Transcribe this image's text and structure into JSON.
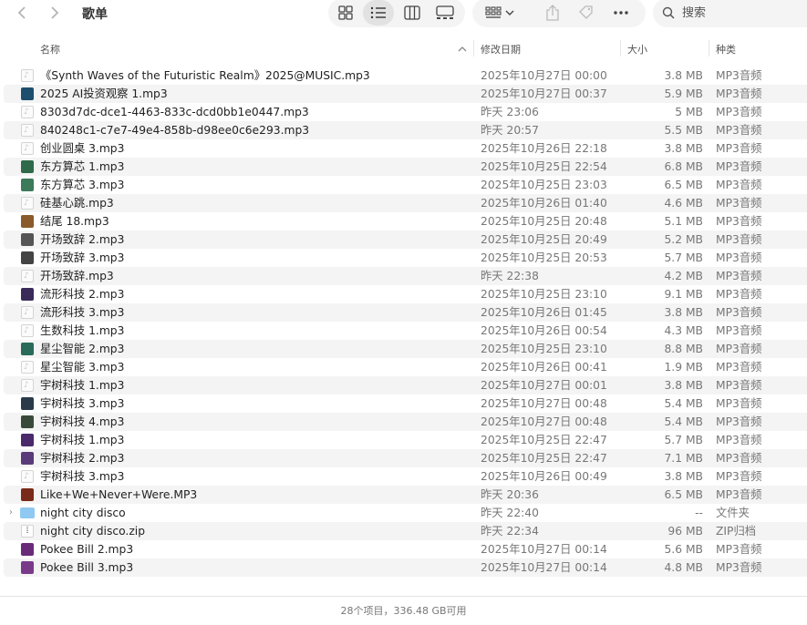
{
  "window": {
    "title": "歌单"
  },
  "toolbar": {
    "search_placeholder": "搜索"
  },
  "columns": {
    "name": "名称",
    "date": "修改日期",
    "size": "大小",
    "kind": "种类"
  },
  "rows": [
    {
      "icon": "doc",
      "name": "《Synth Waves of the Futuristic Realm》2025@MUSIC.mp3",
      "date": "2025年10月27日 00:00",
      "size": "3.8 MB",
      "kind": "MP3音频"
    },
    {
      "icon": "art",
      "color": "#1d4e6e",
      "name": "2025 AI投资观察 1.mp3",
      "date": "2025年10月27日 00:37",
      "size": "5.9 MB",
      "kind": "MP3音频"
    },
    {
      "icon": "doc",
      "name": "8303d7dc-dce1-4463-833c-dcd0bb1e0447.mp3",
      "date": "昨天 23:06",
      "size": "5 MB",
      "kind": "MP3音频"
    },
    {
      "icon": "doc",
      "name": "840248c1-c7e7-49e4-858b-d98ee0c6e293.mp3",
      "date": "昨天 20:57",
      "size": "5.5 MB",
      "kind": "MP3音频"
    },
    {
      "icon": "doc",
      "name": "创业圆桌 3.mp3",
      "date": "2025年10月26日 22:18",
      "size": "3.8 MB",
      "kind": "MP3音频"
    },
    {
      "icon": "art",
      "color": "#2f6a4a",
      "name": "东方算芯 1.mp3",
      "date": "2025年10月25日 22:54",
      "size": "6.8 MB",
      "kind": "MP3音频"
    },
    {
      "icon": "art",
      "color": "#3c7a5a",
      "name": "东方算芯 3.mp3",
      "date": "2025年10月25日 23:03",
      "size": "6.5 MB",
      "kind": "MP3音频"
    },
    {
      "icon": "doc",
      "name": "硅基心跳.mp3",
      "date": "2025年10月26日 01:40",
      "size": "4.6 MB",
      "kind": "MP3音频"
    },
    {
      "icon": "art",
      "color": "#8a5a2a",
      "name": "结尾 18.mp3",
      "date": "2025年10月25日 20:48",
      "size": "5.1 MB",
      "kind": "MP3音频"
    },
    {
      "icon": "art",
      "color": "#555555",
      "name": "开场致辞 2.mp3",
      "date": "2025年10月25日 20:49",
      "size": "5.2 MB",
      "kind": "MP3音频"
    },
    {
      "icon": "art",
      "color": "#444444",
      "name": "开场致辞 3.mp3",
      "date": "2025年10月25日 20:53",
      "size": "5.7 MB",
      "kind": "MP3音频"
    },
    {
      "icon": "doc",
      "name": "开场致辞.mp3",
      "date": "昨天 22:38",
      "size": "4.2 MB",
      "kind": "MP3音频"
    },
    {
      "icon": "art",
      "color": "#3a2a5a",
      "name": "流形科技  2.mp3",
      "date": "2025年10月25日 23:10",
      "size": "9.1 MB",
      "kind": "MP3音频"
    },
    {
      "icon": "doc",
      "name": "流形科技 3.mp3",
      "date": "2025年10月26日 01:45",
      "size": "3.8 MB",
      "kind": "MP3音频"
    },
    {
      "icon": "doc",
      "name": "生数科技 1.mp3",
      "date": "2025年10月26日 00:54",
      "size": "4.3 MB",
      "kind": "MP3音频"
    },
    {
      "icon": "art",
      "color": "#2a6a5a",
      "name": "星尘智能  2.mp3",
      "date": "2025年10月25日 23:10",
      "size": "8.8 MB",
      "kind": "MP3音频"
    },
    {
      "icon": "doc",
      "name": "星尘智能 3.mp3",
      "date": "2025年10月26日 00:41",
      "size": "1.9 MB",
      "kind": "MP3音频"
    },
    {
      "icon": "doc",
      "name": "宇树科技 1.mp3",
      "date": "2025年10月27日 00:01",
      "size": "3.8 MB",
      "kind": "MP3音频"
    },
    {
      "icon": "art",
      "color": "#2a3a4a",
      "name": "宇树科技 3.mp3",
      "date": "2025年10月27日 00:48",
      "size": "5.4 MB",
      "kind": "MP3音频"
    },
    {
      "icon": "art",
      "color": "#3a4a3a",
      "name": "宇树科技 4.mp3",
      "date": "2025年10月27日 00:48",
      "size": "5.4 MB",
      "kind": "MP3音频"
    },
    {
      "icon": "art",
      "color": "#4a2a6a",
      "name": "宇树科技 1.mp3",
      "date": "2025年10月25日 22:47",
      "size": "5.7 MB",
      "kind": "MP3音频"
    },
    {
      "icon": "art",
      "color": "#5a3a7a",
      "name": "宇树科技 2.mp3",
      "date": "2025年10月25日 22:47",
      "size": "7.1 MB",
      "kind": "MP3音频"
    },
    {
      "icon": "doc",
      "name": "宇树科技 3.mp3",
      "date": "2025年10月26日 00:49",
      "size": "3.8 MB",
      "kind": "MP3音频"
    },
    {
      "icon": "art",
      "color": "#7a2a1a",
      "name": "Like+We+Never+Were.MP3",
      "date": "昨天 20:36",
      "size": "6.5 MB",
      "kind": "MP3音频"
    },
    {
      "icon": "folder",
      "name": "night city disco",
      "date": "昨天 22:40",
      "size": "--",
      "kind": "文件夹",
      "expandable": true
    },
    {
      "icon": "zip",
      "name": "night city disco.zip",
      "date": "昨天 22:34",
      "size": "96 MB",
      "kind": "ZIP归档"
    },
    {
      "icon": "art",
      "color": "#6a2a7a",
      "name": "Pokee Bill 2.mp3",
      "date": "2025年10月27日 00:14",
      "size": "5.6 MB",
      "kind": "MP3音频"
    },
    {
      "icon": "art",
      "color": "#7a3a8a",
      "name": "Pokee Bill 3.mp3",
      "date": "2025年10月27日 00:14",
      "size": "4.8 MB",
      "kind": "MP3音频"
    }
  ],
  "footer": {
    "status": "28个项目，336.48 GB可用"
  },
  "colors": {
    "stripe": "#f4f4f4",
    "folder": "#8fc9f2"
  }
}
